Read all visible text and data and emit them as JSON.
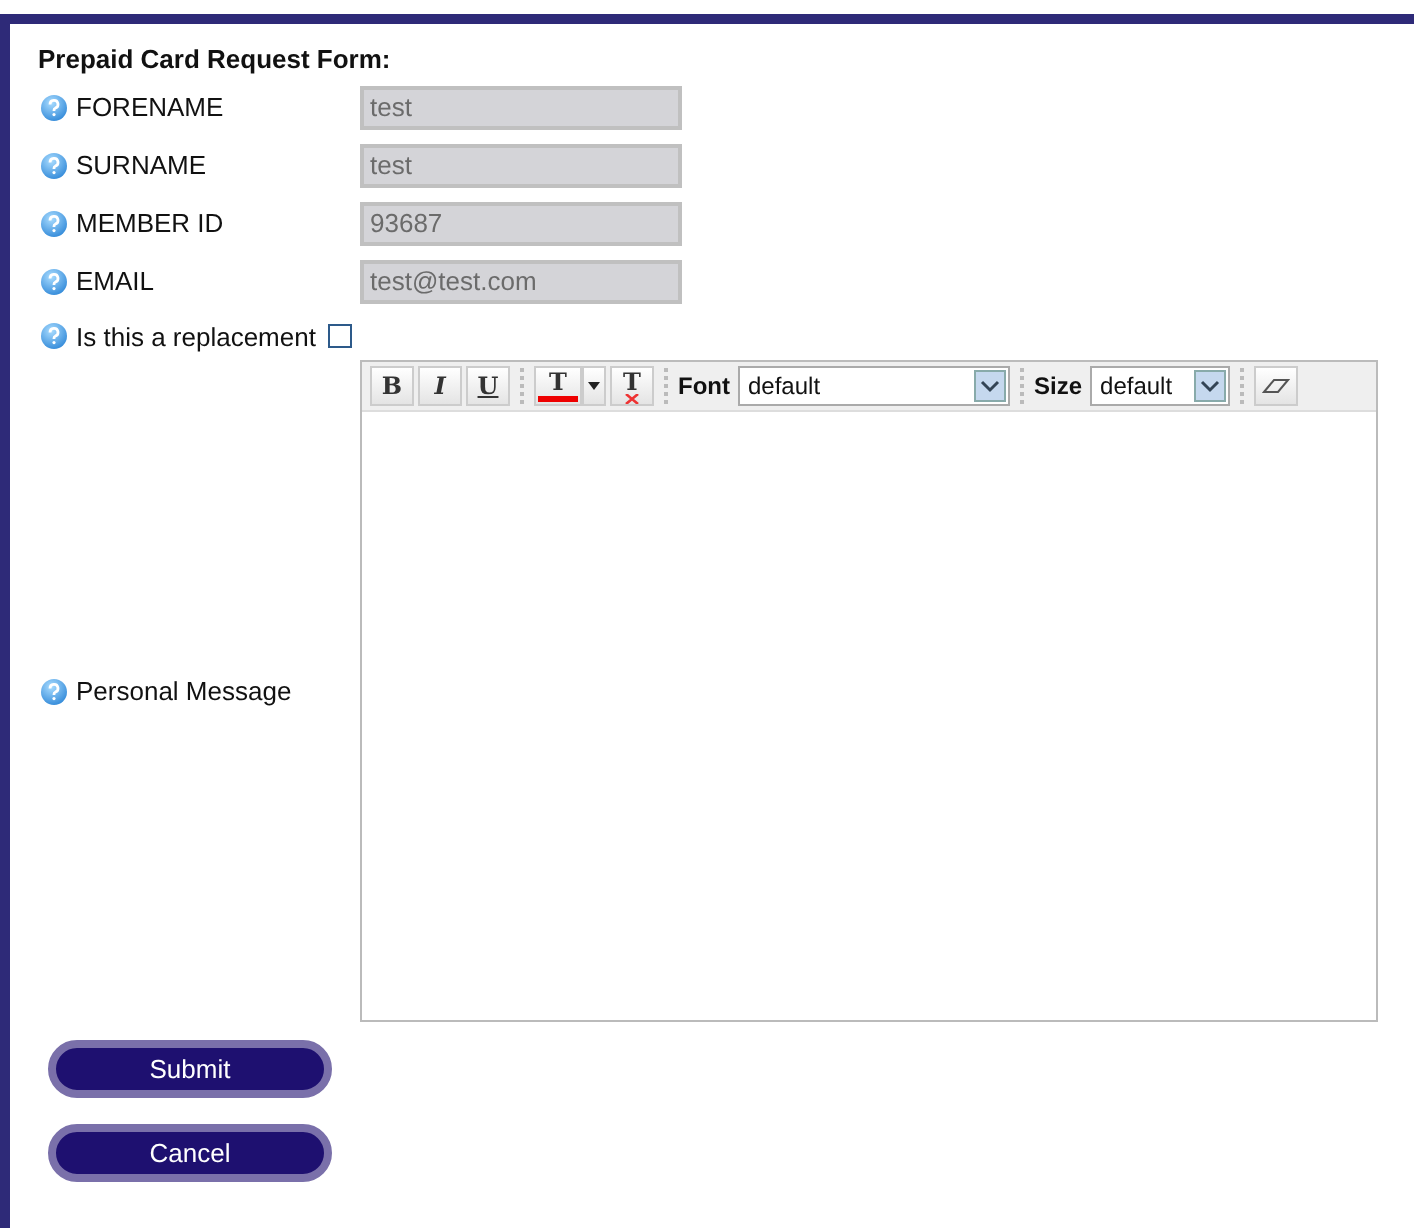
{
  "form": {
    "title": "Prepaid Card Request Form:",
    "fields": [
      {
        "label": "FORENAME",
        "value": "test",
        "disabled": true
      },
      {
        "label": "SURNAME",
        "value": "test",
        "disabled": true
      },
      {
        "label": "MEMBER ID",
        "value": "93687",
        "disabled": true
      },
      {
        "label": "EMAIL",
        "value": "test@test.com",
        "disabled": true
      }
    ],
    "replacement": {
      "label": "Is this a replacement",
      "checked": false
    },
    "message": {
      "label": "Personal Message",
      "toolbar": [
        {
          "kind": "bold",
          "label": "B"
        },
        {
          "kind": "italic",
          "label": "I"
        },
        {
          "kind": "underline",
          "label": "U"
        },
        {
          "kind": "sep"
        },
        {
          "kind": "color",
          "label": "T"
        },
        {
          "kind": "clear",
          "label": "T"
        },
        {
          "kind": "sep"
        },
        {
          "kind": "select",
          "label": "Font",
          "value": "default"
        },
        {
          "kind": "sep"
        },
        {
          "kind": "select",
          "label": "Size",
          "value": "default"
        },
        {
          "kind": "sep"
        },
        {
          "kind": "eraser"
        }
      ]
    },
    "buttons": [
      "Submit",
      "Cancel"
    ]
  }
}
